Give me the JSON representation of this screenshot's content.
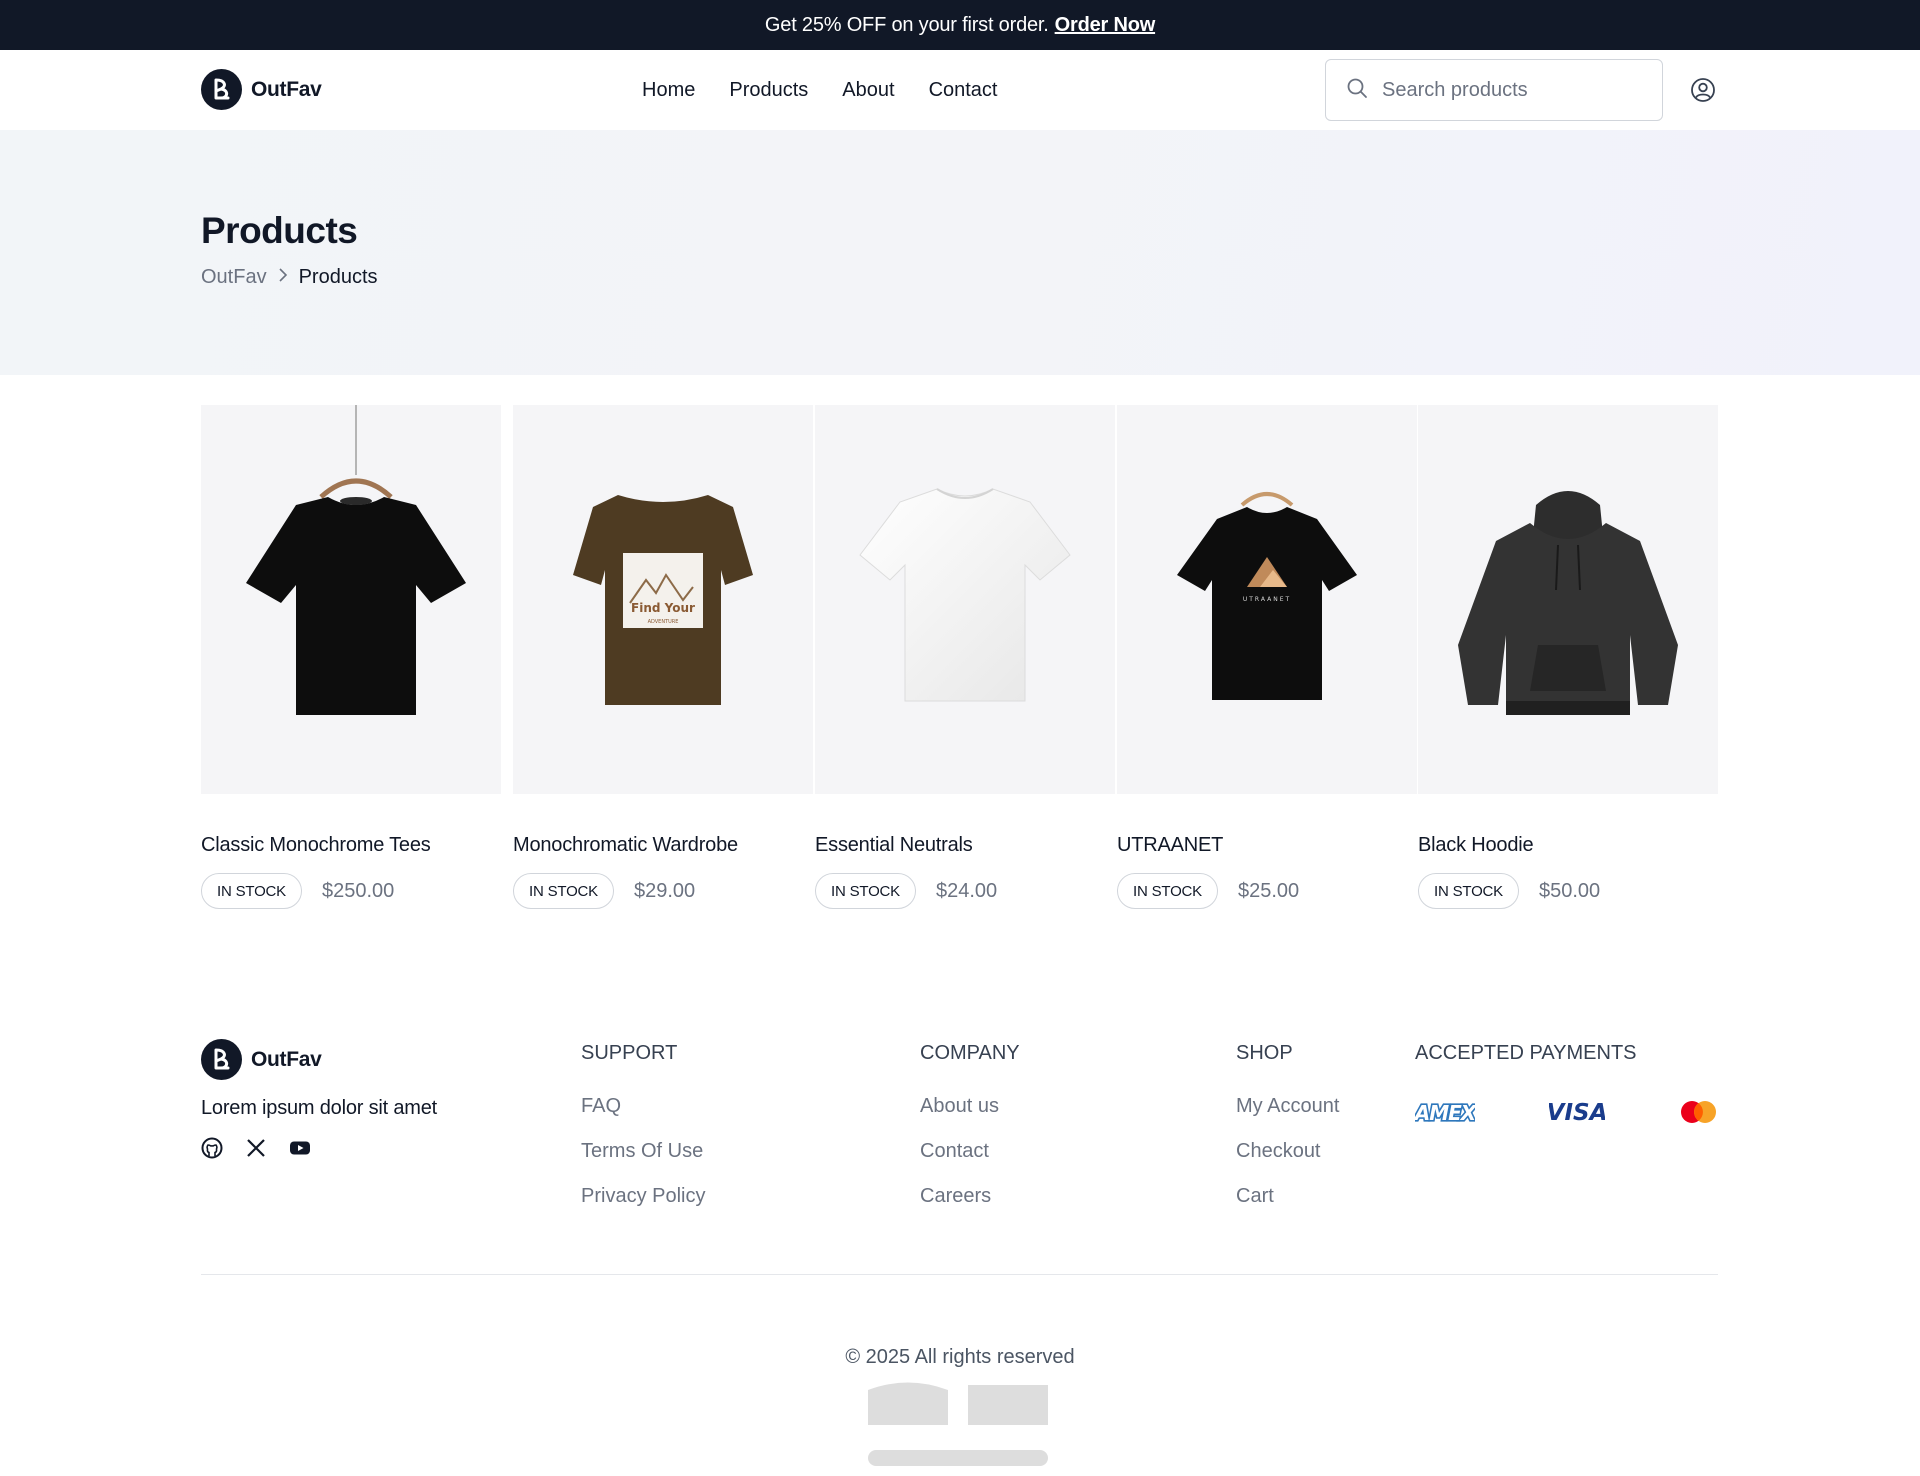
{
  "announcement": {
    "text": "Get 25% OFF on your first order.",
    "link_label": "Order Now"
  },
  "brand": {
    "name": "OutFav"
  },
  "nav": {
    "items": [
      "Home",
      "Products",
      "About",
      "Contact"
    ]
  },
  "search": {
    "placeholder": "Search products",
    "value": ""
  },
  "hero": {
    "title": "Products",
    "breadcrumb": [
      "OutFav",
      "Products"
    ]
  },
  "products": [
    {
      "name": "Classic Monochrome Tees",
      "status": "IN STOCK",
      "price": "$250.00",
      "image": "black-tshirt-on-hanger"
    },
    {
      "name": "Monochromatic Wardrobe",
      "status": "IN STOCK",
      "price": "$29.00",
      "image": "brown-graphic-tshirt"
    },
    {
      "name": "Essential Neutrals",
      "status": "IN STOCK",
      "price": "$24.00",
      "image": "white-tshirt"
    },
    {
      "name": "UTRAANET",
      "status": "IN STOCK",
      "price": "$25.00",
      "image": "black-graphic-tshirt"
    },
    {
      "name": "Black Hoodie",
      "status": "IN STOCK",
      "price": "$50.00",
      "image": "black-hoodie"
    }
  ],
  "footer": {
    "description": "Lorem ipsum dolor sit amet",
    "socials": [
      "github-icon",
      "x-icon",
      "youtube-icon"
    ],
    "support": {
      "title": "SUPPORT",
      "links": [
        "FAQ",
        "Terms Of Use",
        "Privacy Policy"
      ]
    },
    "company": {
      "title": "COMPANY",
      "links": [
        "About us",
        "Contact",
        "Careers"
      ]
    },
    "shop": {
      "title": "SHOP",
      "links": [
        "My Account",
        "Checkout",
        "Cart"
      ]
    },
    "payments": {
      "title": "ACCEPTED PAYMENTS",
      "methods": [
        "AMEX",
        "VISA",
        "mastercard"
      ]
    },
    "copyright": "© 2025 All rights reserved"
  },
  "colors": {
    "dark": "#111827",
    "muted": "#6b7280",
    "border": "#d1d5db",
    "amex": "#2e77bc",
    "visa": "#1a1f71",
    "mc_red": "#eb001b",
    "mc_orange": "#f79e1b"
  }
}
